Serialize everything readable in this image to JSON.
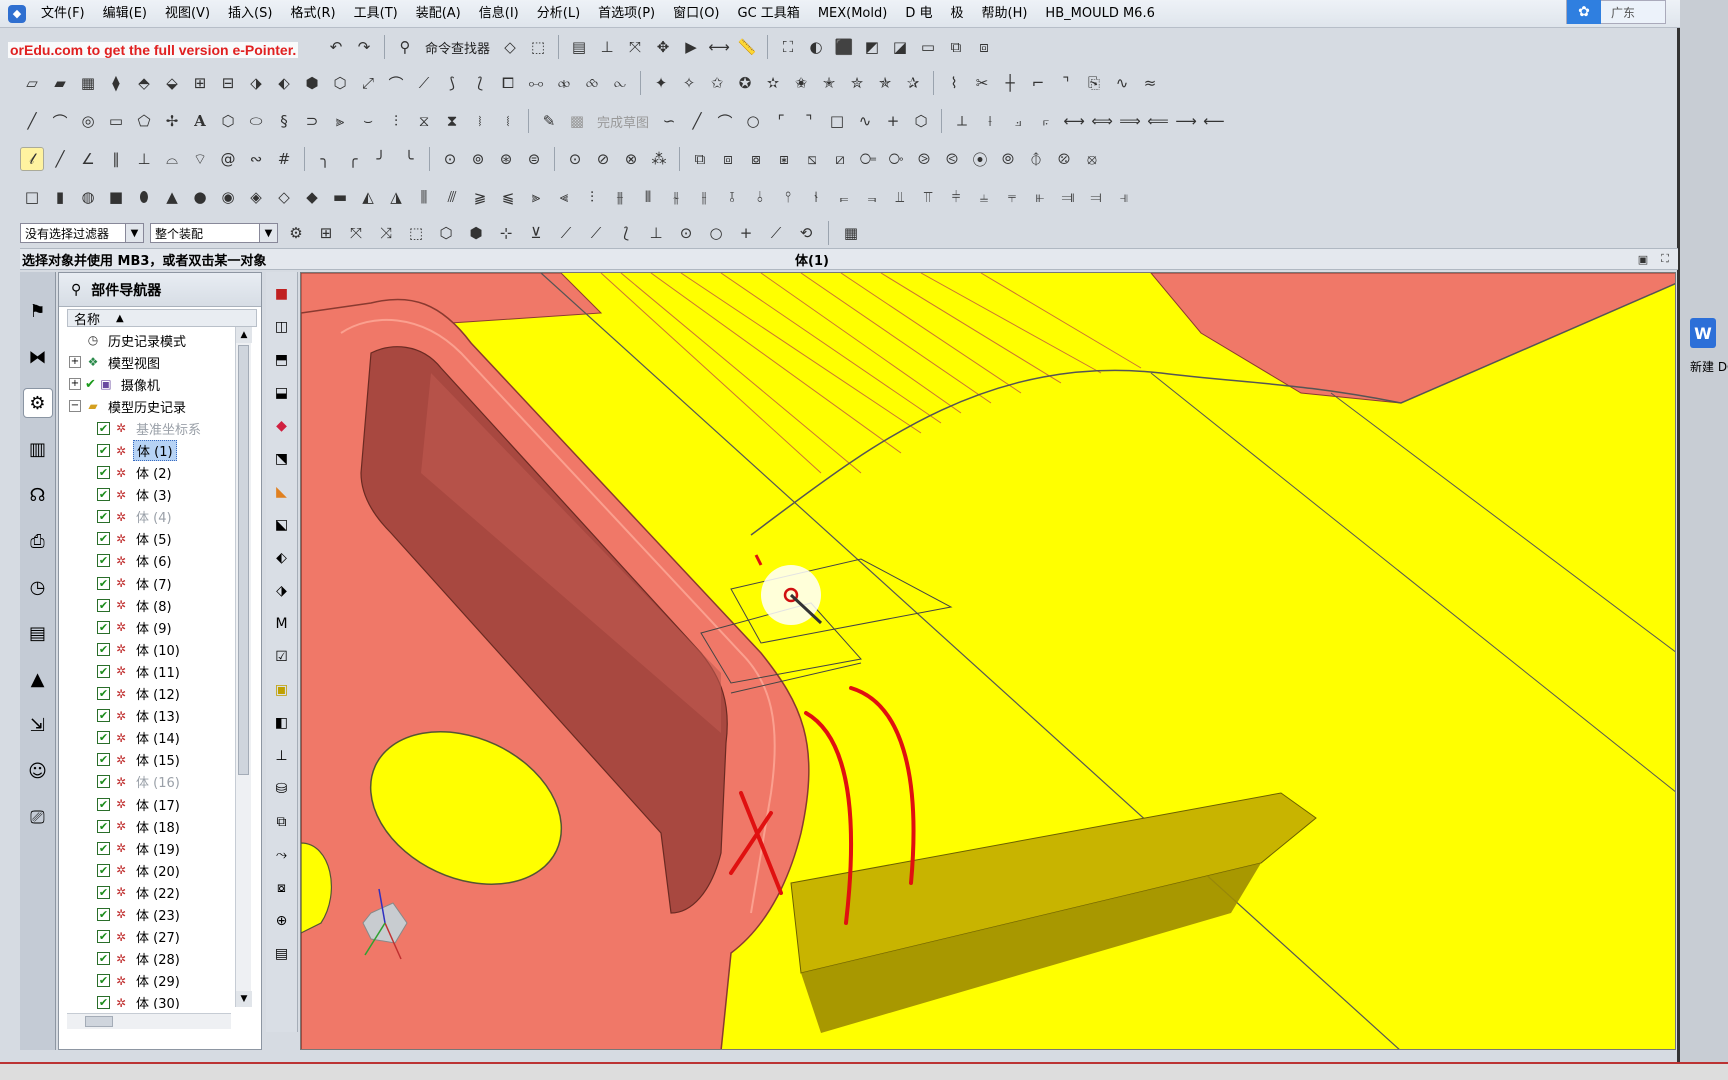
{
  "menubar": {
    "items": [
      "文件(F)",
      "编辑(E)",
      "视图(V)",
      "插入(S)",
      "格式(R)",
      "工具(T)",
      "装配(A)",
      "信息(I)",
      "分析(L)",
      "首选项(P)",
      "窗口(O)",
      "GC 工具箱",
      "MEX(Mold)",
      "D 电",
      "极",
      "帮助(H)",
      "HB_MOULD M6.6"
    ],
    "badge_label": "广东"
  },
  "watermark": "orEdu.com to get the full version e-Pointer.",
  "toolbar": {
    "command_finder": "命令查找器",
    "finish_sketch": "完成草图"
  },
  "filter": {
    "type_filter": "没有选择过滤器",
    "scope": "整个装配"
  },
  "status": {
    "prompt": "选择对象并使用 MB3，或者双击某一对象",
    "selection": "体(1)"
  },
  "navigator": {
    "title": "部件导航器",
    "col_name": "名称",
    "rows": [
      {
        "label": "历史记录模式",
        "type": "clock",
        "indent": 0,
        "grey": false
      },
      {
        "label": "模型视图",
        "type": "expand",
        "indent": 0,
        "grey": false
      },
      {
        "label": "摄像机",
        "type": "expand-check",
        "indent": 0,
        "grey": false
      },
      {
        "label": "模型历史记录",
        "type": "folder",
        "indent": 0,
        "grey": false
      },
      {
        "label": "基准坐标系",
        "type": "item",
        "indent": 1,
        "grey": true
      },
      {
        "label": "体 (1)",
        "type": "item",
        "indent": 1,
        "grey": false,
        "selected": true
      },
      {
        "label": "体 (2)",
        "type": "item",
        "indent": 1,
        "grey": false
      },
      {
        "label": "体 (3)",
        "type": "item",
        "indent": 1,
        "grey": false
      },
      {
        "label": "体 (4)",
        "type": "item",
        "indent": 1,
        "grey": true
      },
      {
        "label": "体 (5)",
        "type": "item",
        "indent": 1,
        "grey": false
      },
      {
        "label": "体 (6)",
        "type": "item",
        "indent": 1,
        "grey": false
      },
      {
        "label": "体 (7)",
        "type": "item",
        "indent": 1,
        "grey": false
      },
      {
        "label": "体 (8)",
        "type": "item",
        "indent": 1,
        "grey": false
      },
      {
        "label": "体 (9)",
        "type": "item",
        "indent": 1,
        "grey": false
      },
      {
        "label": "体 (10)",
        "type": "item",
        "indent": 1,
        "grey": false
      },
      {
        "label": "体 (11)",
        "type": "item",
        "indent": 1,
        "grey": false
      },
      {
        "label": "体 (12)",
        "type": "item",
        "indent": 1,
        "grey": false
      },
      {
        "label": "体 (13)",
        "type": "item",
        "indent": 1,
        "grey": false
      },
      {
        "label": "体 (14)",
        "type": "item",
        "indent": 1,
        "grey": false
      },
      {
        "label": "体 (15)",
        "type": "item",
        "indent": 1,
        "grey": false
      },
      {
        "label": "体 (16)",
        "type": "item",
        "indent": 1,
        "grey": true
      },
      {
        "label": "体 (17)",
        "type": "item",
        "indent": 1,
        "grey": false
      },
      {
        "label": "体 (18)",
        "type": "item",
        "indent": 1,
        "grey": false
      },
      {
        "label": "体 (19)",
        "type": "item",
        "indent": 1,
        "grey": false
      },
      {
        "label": "体 (20)",
        "type": "item",
        "indent": 1,
        "grey": false
      },
      {
        "label": "体 (22)",
        "type": "item",
        "indent": 1,
        "grey": false
      },
      {
        "label": "体 (23)",
        "type": "item",
        "indent": 1,
        "grey": false
      },
      {
        "label": "体 (27)",
        "type": "item",
        "indent": 1,
        "grey": false
      },
      {
        "label": "体 (28)",
        "type": "item",
        "indent": 1,
        "grey": false
      },
      {
        "label": "体 (29)",
        "type": "item",
        "indent": 1,
        "grey": false
      },
      {
        "label": "体 (30)",
        "type": "item",
        "indent": 1,
        "grey": false
      }
    ]
  },
  "side": {
    "word_icon": "W",
    "text": "新建 DO"
  },
  "colors": {
    "viewport_bg": "#ffff00",
    "part_salmon": "#f07868",
    "part_dark": "#a84840",
    "selection_blue": "#b7d3f5"
  }
}
